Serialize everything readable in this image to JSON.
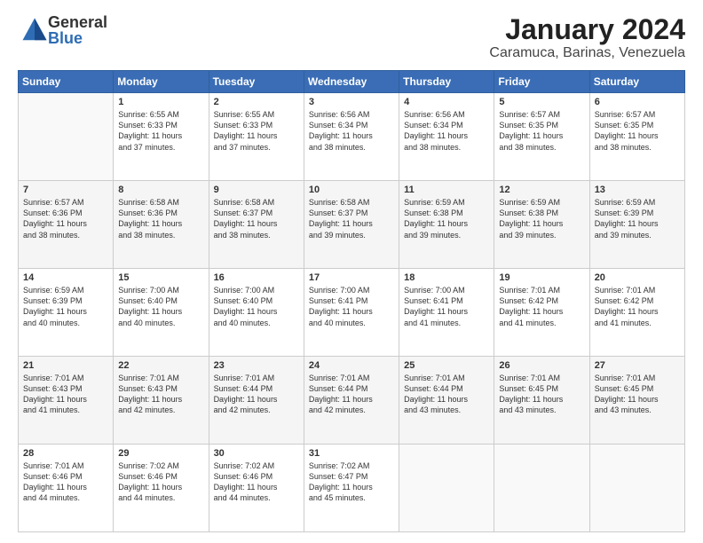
{
  "logo": {
    "general": "General",
    "blue": "Blue"
  },
  "title": {
    "month": "January 2024",
    "location": "Caramuca, Barinas, Venezuela"
  },
  "weekdays": [
    "Sunday",
    "Monday",
    "Tuesday",
    "Wednesday",
    "Thursday",
    "Friday",
    "Saturday"
  ],
  "weeks": [
    [
      {
        "day": "",
        "content": ""
      },
      {
        "day": "1",
        "content": "Sunrise: 6:55 AM\nSunset: 6:33 PM\nDaylight: 11 hours\nand 37 minutes."
      },
      {
        "day": "2",
        "content": "Sunrise: 6:55 AM\nSunset: 6:33 PM\nDaylight: 11 hours\nand 37 minutes."
      },
      {
        "day": "3",
        "content": "Sunrise: 6:56 AM\nSunset: 6:34 PM\nDaylight: 11 hours\nand 38 minutes."
      },
      {
        "day": "4",
        "content": "Sunrise: 6:56 AM\nSunset: 6:34 PM\nDaylight: 11 hours\nand 38 minutes."
      },
      {
        "day": "5",
        "content": "Sunrise: 6:57 AM\nSunset: 6:35 PM\nDaylight: 11 hours\nand 38 minutes."
      },
      {
        "day": "6",
        "content": "Sunrise: 6:57 AM\nSunset: 6:35 PM\nDaylight: 11 hours\nand 38 minutes."
      }
    ],
    [
      {
        "day": "7",
        "content": "Sunrise: 6:57 AM\nSunset: 6:36 PM\nDaylight: 11 hours\nand 38 minutes."
      },
      {
        "day": "8",
        "content": "Sunrise: 6:58 AM\nSunset: 6:36 PM\nDaylight: 11 hours\nand 38 minutes."
      },
      {
        "day": "9",
        "content": "Sunrise: 6:58 AM\nSunset: 6:37 PM\nDaylight: 11 hours\nand 38 minutes."
      },
      {
        "day": "10",
        "content": "Sunrise: 6:58 AM\nSunset: 6:37 PM\nDaylight: 11 hours\nand 39 minutes."
      },
      {
        "day": "11",
        "content": "Sunrise: 6:59 AM\nSunset: 6:38 PM\nDaylight: 11 hours\nand 39 minutes."
      },
      {
        "day": "12",
        "content": "Sunrise: 6:59 AM\nSunset: 6:38 PM\nDaylight: 11 hours\nand 39 minutes."
      },
      {
        "day": "13",
        "content": "Sunrise: 6:59 AM\nSunset: 6:39 PM\nDaylight: 11 hours\nand 39 minutes."
      }
    ],
    [
      {
        "day": "14",
        "content": "Sunrise: 6:59 AM\nSunset: 6:39 PM\nDaylight: 11 hours\nand 40 minutes."
      },
      {
        "day": "15",
        "content": "Sunrise: 7:00 AM\nSunset: 6:40 PM\nDaylight: 11 hours\nand 40 minutes."
      },
      {
        "day": "16",
        "content": "Sunrise: 7:00 AM\nSunset: 6:40 PM\nDaylight: 11 hours\nand 40 minutes."
      },
      {
        "day": "17",
        "content": "Sunrise: 7:00 AM\nSunset: 6:41 PM\nDaylight: 11 hours\nand 40 minutes."
      },
      {
        "day": "18",
        "content": "Sunrise: 7:00 AM\nSunset: 6:41 PM\nDaylight: 11 hours\nand 41 minutes."
      },
      {
        "day": "19",
        "content": "Sunrise: 7:01 AM\nSunset: 6:42 PM\nDaylight: 11 hours\nand 41 minutes."
      },
      {
        "day": "20",
        "content": "Sunrise: 7:01 AM\nSunset: 6:42 PM\nDaylight: 11 hours\nand 41 minutes."
      }
    ],
    [
      {
        "day": "21",
        "content": "Sunrise: 7:01 AM\nSunset: 6:43 PM\nDaylight: 11 hours\nand 41 minutes."
      },
      {
        "day": "22",
        "content": "Sunrise: 7:01 AM\nSunset: 6:43 PM\nDaylight: 11 hours\nand 42 minutes."
      },
      {
        "day": "23",
        "content": "Sunrise: 7:01 AM\nSunset: 6:44 PM\nDaylight: 11 hours\nand 42 minutes."
      },
      {
        "day": "24",
        "content": "Sunrise: 7:01 AM\nSunset: 6:44 PM\nDaylight: 11 hours\nand 42 minutes."
      },
      {
        "day": "25",
        "content": "Sunrise: 7:01 AM\nSunset: 6:44 PM\nDaylight: 11 hours\nand 43 minutes."
      },
      {
        "day": "26",
        "content": "Sunrise: 7:01 AM\nSunset: 6:45 PM\nDaylight: 11 hours\nand 43 minutes."
      },
      {
        "day": "27",
        "content": "Sunrise: 7:01 AM\nSunset: 6:45 PM\nDaylight: 11 hours\nand 43 minutes."
      }
    ],
    [
      {
        "day": "28",
        "content": "Sunrise: 7:01 AM\nSunset: 6:46 PM\nDaylight: 11 hours\nand 44 minutes."
      },
      {
        "day": "29",
        "content": "Sunrise: 7:02 AM\nSunset: 6:46 PM\nDaylight: 11 hours\nand 44 minutes."
      },
      {
        "day": "30",
        "content": "Sunrise: 7:02 AM\nSunset: 6:46 PM\nDaylight: 11 hours\nand 44 minutes."
      },
      {
        "day": "31",
        "content": "Sunrise: 7:02 AM\nSunset: 6:47 PM\nDaylight: 11 hours\nand 45 minutes."
      },
      {
        "day": "",
        "content": ""
      },
      {
        "day": "",
        "content": ""
      },
      {
        "day": "",
        "content": ""
      }
    ]
  ]
}
